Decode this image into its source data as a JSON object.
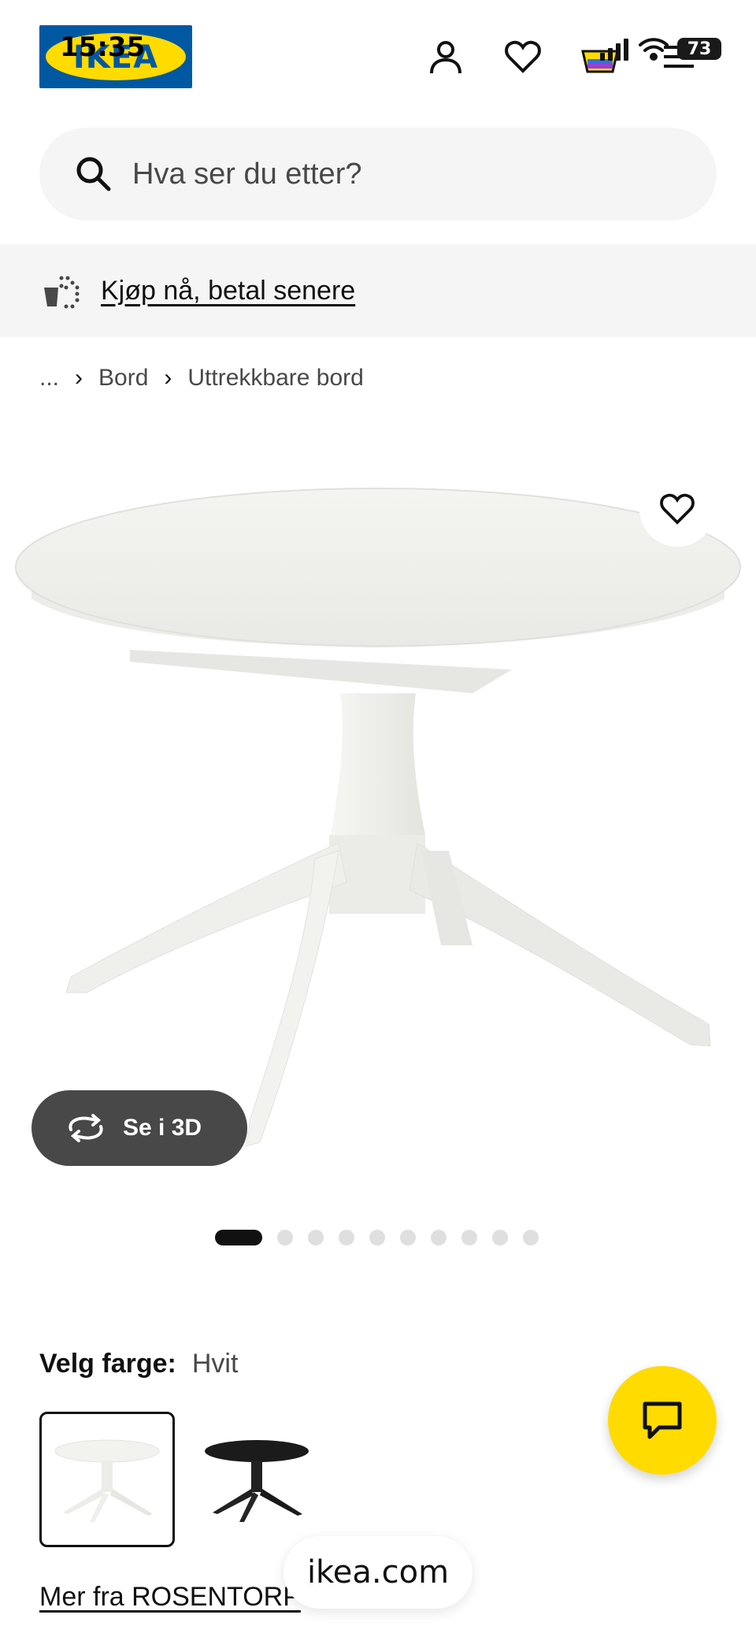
{
  "status_bar": {
    "time": "15:35",
    "battery": "73"
  },
  "header": {
    "logo_text": "IKEA",
    "icons": [
      "profile-icon",
      "heart-icon",
      "cart-icon",
      "menu-icon"
    ]
  },
  "search": {
    "placeholder": "Hva ser du etter?"
  },
  "promo": {
    "text": "Kjøp nå, betal senere"
  },
  "breadcrumb": {
    "ellipsis": "...",
    "items": [
      "Bord",
      "Uttrekkbare bord"
    ]
  },
  "product": {
    "view_3d_label": "Se i 3D",
    "carousel": {
      "total": 10,
      "active_index": 0
    }
  },
  "color_selector": {
    "label": "Velg farge:",
    "value": "Hvit",
    "swatches": [
      "Hvit",
      "Svart"
    ]
  },
  "more_link": "Mer fra ROSENTORP",
  "browser_url": "ikea.com",
  "colors": {
    "ikea_blue": "#0058a3",
    "ikea_yellow": "#ffdb00",
    "dark_button": "#484848"
  }
}
